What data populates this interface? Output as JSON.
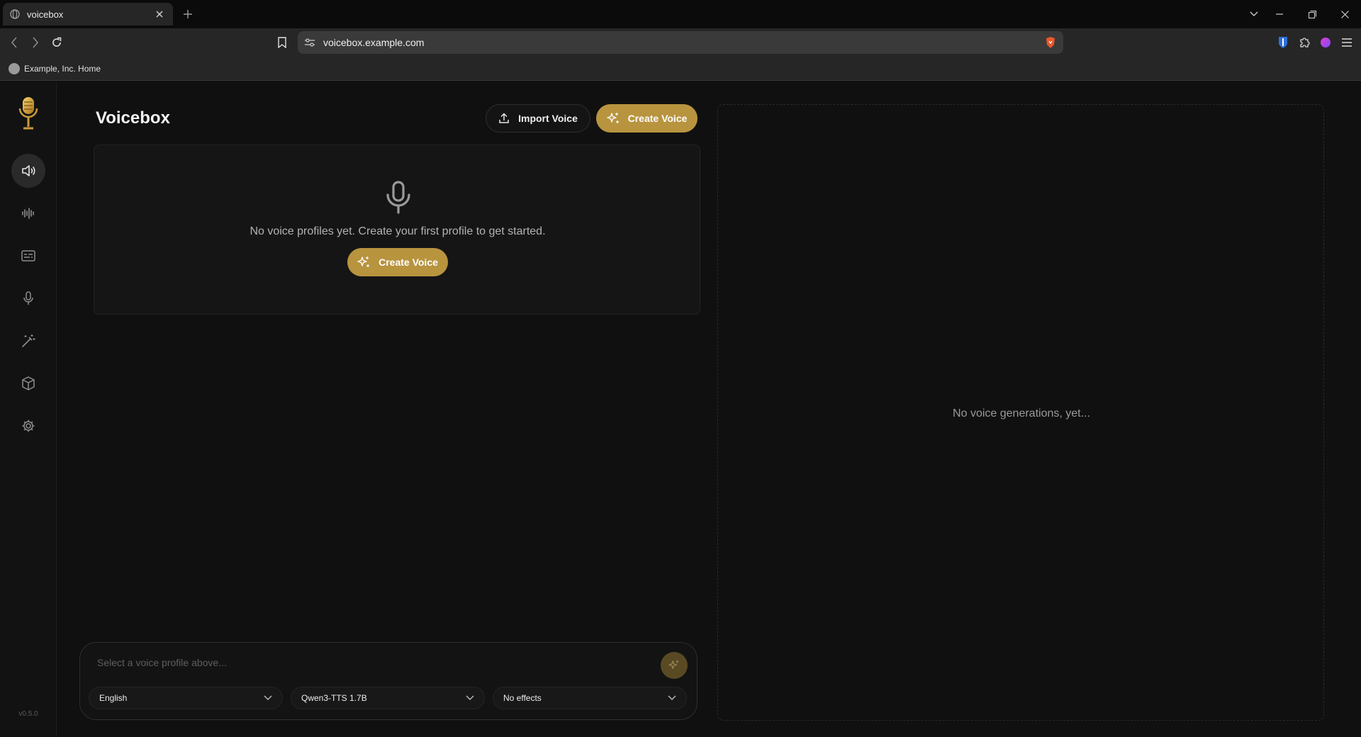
{
  "browser": {
    "tab_title": "voicebox",
    "url": "voicebox.example.com",
    "bookmark": "Example, Inc. Home"
  },
  "sidebar": {
    "items": [
      {
        "name": "voices",
        "icon": "speaker-icon",
        "active": true
      },
      {
        "name": "generations",
        "icon": "waveform-icon",
        "active": false
      },
      {
        "name": "captions",
        "icon": "captions-icon",
        "active": false
      },
      {
        "name": "record",
        "icon": "microphone-icon",
        "active": false
      },
      {
        "name": "effects",
        "icon": "magic-wand-icon",
        "active": false
      },
      {
        "name": "models",
        "icon": "cube-icon",
        "active": false
      },
      {
        "name": "settings",
        "icon": "gear-icon",
        "active": false
      }
    ],
    "version": "v0.5.0"
  },
  "header": {
    "title": "Voicebox",
    "import_label": "Import Voice",
    "create_label": "Create Voice"
  },
  "profiles": {
    "empty_text": "No voice profiles yet. Create your first profile to get started.",
    "create_label": "Create Voice"
  },
  "composer": {
    "placeholder": "Select a voice profile above...",
    "language": "English",
    "model": "Qwen3-TTS 1.7B",
    "effects": "No effects"
  },
  "generations": {
    "empty_text": "No voice generations, yet..."
  },
  "colors": {
    "accent": "#b8943f",
    "background": "#101010"
  }
}
